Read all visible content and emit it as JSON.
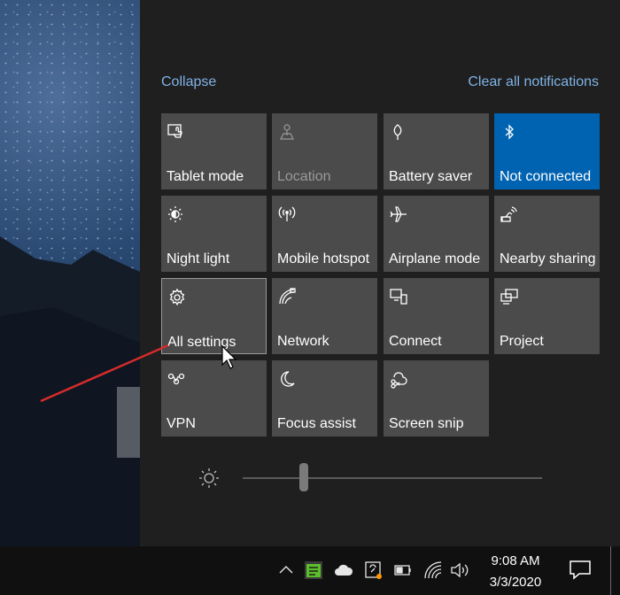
{
  "action_center": {
    "collapse_label": "Collapse",
    "clear_all_label": "Clear all notifications",
    "tiles": [
      {
        "label": "Tablet mode",
        "icon": "tablet-mode-icon",
        "state": "off"
      },
      {
        "label": "Location",
        "icon": "location-icon",
        "state": "disabled"
      },
      {
        "label": "Battery saver",
        "icon": "battery-saver-icon",
        "state": "off"
      },
      {
        "label": "Not connected",
        "icon": "bluetooth-icon",
        "state": "on"
      },
      {
        "label": "Night light",
        "icon": "night-light-icon",
        "state": "off"
      },
      {
        "label": "Mobile hotspot",
        "icon": "mobile-hotspot-icon",
        "state": "off"
      },
      {
        "label": "Airplane mode",
        "icon": "airplane-icon",
        "state": "off"
      },
      {
        "label": "Nearby sharing",
        "icon": "nearby-sharing-icon",
        "state": "off"
      },
      {
        "label": "All settings",
        "icon": "gear-icon",
        "state": "focused"
      },
      {
        "label": "Network",
        "icon": "network-icon",
        "state": "off"
      },
      {
        "label": "Connect",
        "icon": "connect-icon",
        "state": "off"
      },
      {
        "label": "Project",
        "icon": "project-icon",
        "state": "off"
      },
      {
        "label": "VPN",
        "icon": "vpn-icon",
        "state": "off"
      },
      {
        "label": "Focus assist",
        "icon": "moon-icon",
        "state": "off"
      },
      {
        "label": "Screen snip",
        "icon": "screen-snip-icon",
        "state": "off"
      }
    ],
    "brightness": {
      "icon": "brightness-icon",
      "level": 0.2
    }
  },
  "taskbar": {
    "time": "9:08 AM",
    "date": "3/3/2020",
    "tray_icons": [
      "chevron-up-icon",
      "app-tray-icon",
      "onedrive-icon",
      "snip-tray-icon",
      "battery-icon",
      "wifi-icon",
      "volume-icon"
    ]
  },
  "colors": {
    "accent": "#0063b1",
    "tile": "#4b4b4b",
    "panel": "#1f1f1f",
    "link": "#7fb3e6",
    "annotation": "#d62b2b"
  }
}
